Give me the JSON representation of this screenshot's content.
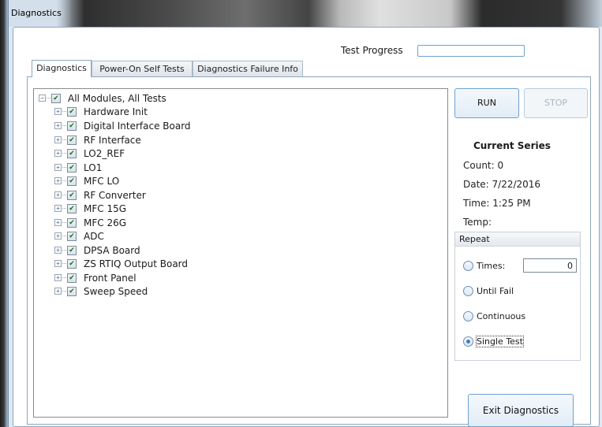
{
  "window": {
    "title": "Diagnostics"
  },
  "progress": {
    "label": "Test Progress",
    "value_percent": 0
  },
  "tabs": [
    {
      "label": "Diagnostics",
      "active": true
    },
    {
      "label": "Power-On Self Tests",
      "active": false
    },
    {
      "label": "Diagnostics Failure Info",
      "active": false
    }
  ],
  "tree": {
    "root": {
      "label": "All Modules, All Tests",
      "checked": true,
      "expander": "−"
    },
    "items": [
      {
        "label": "Hardware Init",
        "checked": true,
        "expander": "+"
      },
      {
        "label": "Digital Interface Board",
        "checked": true,
        "expander": "+"
      },
      {
        "label": "RF Interface",
        "checked": true,
        "expander": "+"
      },
      {
        "label": "LO2_REF",
        "checked": true,
        "expander": "+"
      },
      {
        "label": "LO1",
        "checked": true,
        "expander": "+"
      },
      {
        "label": "MFC LO",
        "checked": true,
        "expander": "+"
      },
      {
        "label": "RF Converter",
        "checked": true,
        "expander": "+"
      },
      {
        "label": "MFC 15G",
        "checked": true,
        "expander": "+"
      },
      {
        "label": "MFC 26G",
        "checked": true,
        "expander": "+"
      },
      {
        "label": "ADC",
        "checked": true,
        "expander": "+"
      },
      {
        "label": "DPSA Board",
        "checked": true,
        "expander": "+"
      },
      {
        "label": "ZS RTIQ Output Board",
        "checked": true,
        "expander": "+"
      },
      {
        "label": "Front Panel",
        "checked": true,
        "expander": "+"
      },
      {
        "label": "Sweep Speed",
        "checked": true,
        "expander": "+"
      }
    ]
  },
  "buttons": {
    "run": "RUN",
    "stop": "STOP",
    "exit": "Exit Diagnostics"
  },
  "series": {
    "title": "Current Series",
    "count": "Count: 0",
    "date": "Date:  7/22/2016",
    "time": "Time:  1:25 PM",
    "temp": "Temp:"
  },
  "repeat": {
    "header": "Repeat",
    "times_label": "Times:",
    "times_value": "0",
    "until_fail": "Until Fail",
    "continuous": "Continuous",
    "single_test": "Single Test",
    "selected": "single_test"
  },
  "icons": {
    "check": "✔"
  },
  "colors": {
    "accent": "#6fa0d0",
    "window_bg": "#dde9f5",
    "radio_dot": "#3f7fc4"
  }
}
